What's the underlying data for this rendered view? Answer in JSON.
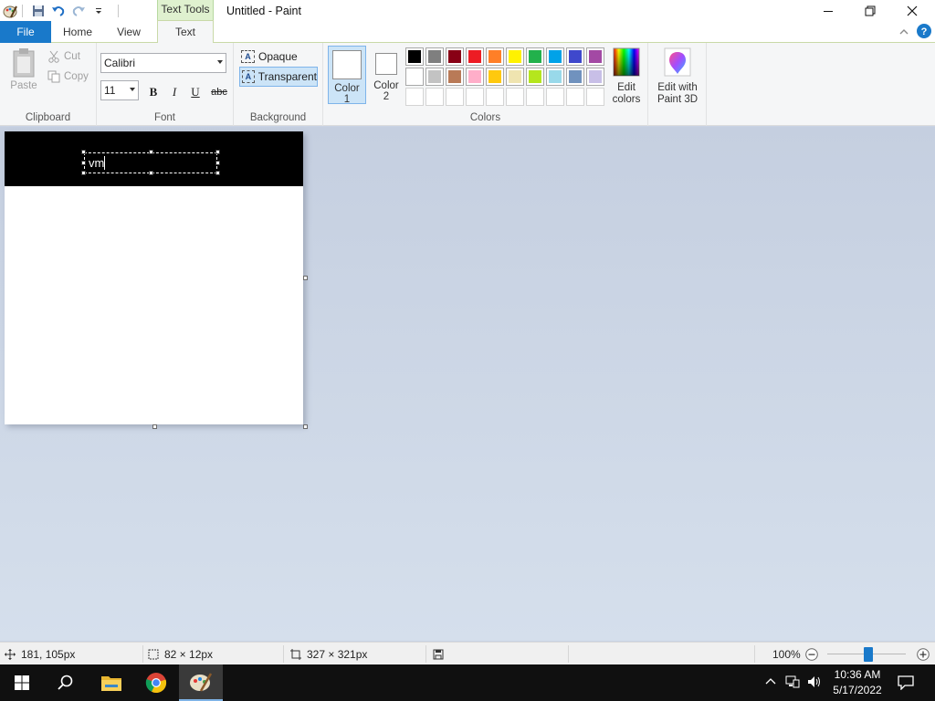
{
  "window": {
    "title": "Untitled - Paint",
    "contextual_tab_header": "Text Tools"
  },
  "tabs": {
    "file": "File",
    "home": "Home",
    "view": "View",
    "text": "Text"
  },
  "ribbon": {
    "clipboard": {
      "label": "Clipboard",
      "paste": "Paste",
      "cut": "Cut",
      "copy": "Copy"
    },
    "font": {
      "label": "Font",
      "family": "Calibri",
      "size": "11",
      "bold": "B",
      "italic": "I",
      "underline": "U",
      "strike": "abc"
    },
    "background": {
      "label": "Background",
      "opaque": "Opaque",
      "transparent": "Transparent",
      "selected": "Transparent"
    },
    "colors": {
      "label": "Colors",
      "color1_line1": "Color",
      "color1_line2": "1",
      "color2_line1": "Color",
      "color2_line2": "2",
      "color1_value": "#ffffff",
      "color2_value": "#ffffff",
      "palette": [
        "#000000",
        "#7f7f7f",
        "#880015",
        "#ed1c24",
        "#ff7f27",
        "#fff200",
        "#22b14c",
        "#00a2e8",
        "#3f48cc",
        "#a349a4",
        "#ffffff",
        "#c3c3c3",
        "#b97a57",
        "#ffaec9",
        "#ffc90e",
        "#efe4b0",
        "#b5e61d",
        "#99d9ea",
        "#7092be",
        "#c8bfe7",
        "",
        "",
        "",
        "",
        "",
        "",
        "",
        "",
        "",
        ""
      ],
      "edit_line1": "Edit",
      "edit_line2": "colors"
    },
    "paint3d": {
      "line1": "Edit with",
      "line2": "Paint 3D"
    }
  },
  "canvas": {
    "text_content": "vm",
    "background_top": "#000000",
    "background": "#ffffff"
  },
  "status": {
    "cursor_pos": "181, 105px",
    "selection_size": "82 × 12px",
    "image_size": "327 × 321px",
    "zoom": "100%"
  },
  "taskbar": {
    "time": "10:36 AM",
    "date": "5/17/2022"
  },
  "accent": "#1979ca"
}
